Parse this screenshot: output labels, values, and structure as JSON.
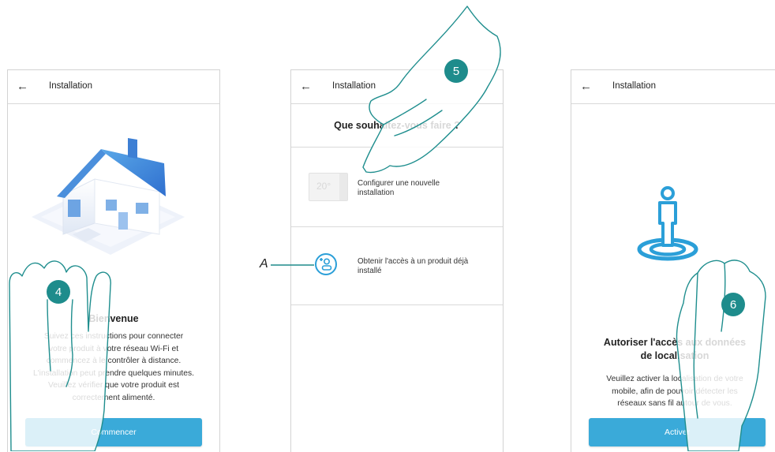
{
  "screens": [
    {
      "header_title": "Installation",
      "heading": "Bienvenue",
      "lines": [
        "Suivez ces instructions pour connecter",
        "votre produit à votre réseau Wi-Fi et",
        "commencez à le contrôler à distance.",
        "L'installation peut prendre quelques minutes.",
        "Veuillez vérifier que votre produit est",
        "correctement alimenté."
      ],
      "button_label": "Commencer"
    },
    {
      "header_title": "Installation",
      "heading": "Que souhaitez-vous faire ?",
      "options": [
        {
          "label_line1": "Configurer une nouvelle",
          "label_line2": "installation",
          "thermostat_display": "20°"
        },
        {
          "label_line1": "Obtenir l'accès à un produit déjà",
          "label_line2": "installé"
        }
      ]
    },
    {
      "header_title": "Installation",
      "heading_line1": "Autoriser l'accès aux données",
      "heading_line2": "de localisation",
      "lines": [
        "Veuillez activer la localisation de votre",
        "mobile, afin de pouvoir détecter les",
        "réseaux sans fil autour de vous."
      ],
      "button_label": "Activer"
    }
  ],
  "steps": [
    "4",
    "5",
    "6"
  ],
  "callout_label": "A",
  "colors": {
    "button": "#3aaad9",
    "badge": "#1e8c8c",
    "accent_icon": "#2b9fd8"
  },
  "icons": [
    "back-arrow-icon",
    "house-illustration",
    "thermostat-icon",
    "add-user-icon",
    "location-person-icon",
    "hand-pointer-icon"
  ]
}
